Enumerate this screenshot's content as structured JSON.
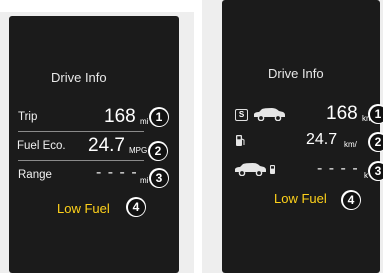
{
  "type_label": "Type B",
  "left_display": {
    "title": "Drive Info",
    "trip": {
      "label": "Trip",
      "value": "168",
      "unit": "mi"
    },
    "fuel_economy": {
      "label": "Fuel Eco.",
      "value": "24.7",
      "unit": "MPG"
    },
    "range": {
      "label": "Range",
      "value": "- - - -",
      "unit": "mi"
    },
    "low_fuel": "Low Fuel"
  },
  "right_display": {
    "title": "Drive Info",
    "trip": {
      "badge": "S",
      "value": "168",
      "unit": "km"
    },
    "fuel_economy": {
      "value": "24.7",
      "unit": "km/"
    },
    "range": {
      "value": "- - - -",
      "unit": "k"
    },
    "low_fuel": "Low Fuel",
    "icons": [
      "trip-car-icon",
      "fuel-pump-icon",
      "range-car-fuel-icon"
    ]
  },
  "callouts": [
    "1",
    "2",
    "3",
    "4"
  ],
  "colors": {
    "screen_bg": "#1b1b1b",
    "low_fuel_text": "#ffd21a",
    "panel_bg": "#eeeeee"
  }
}
